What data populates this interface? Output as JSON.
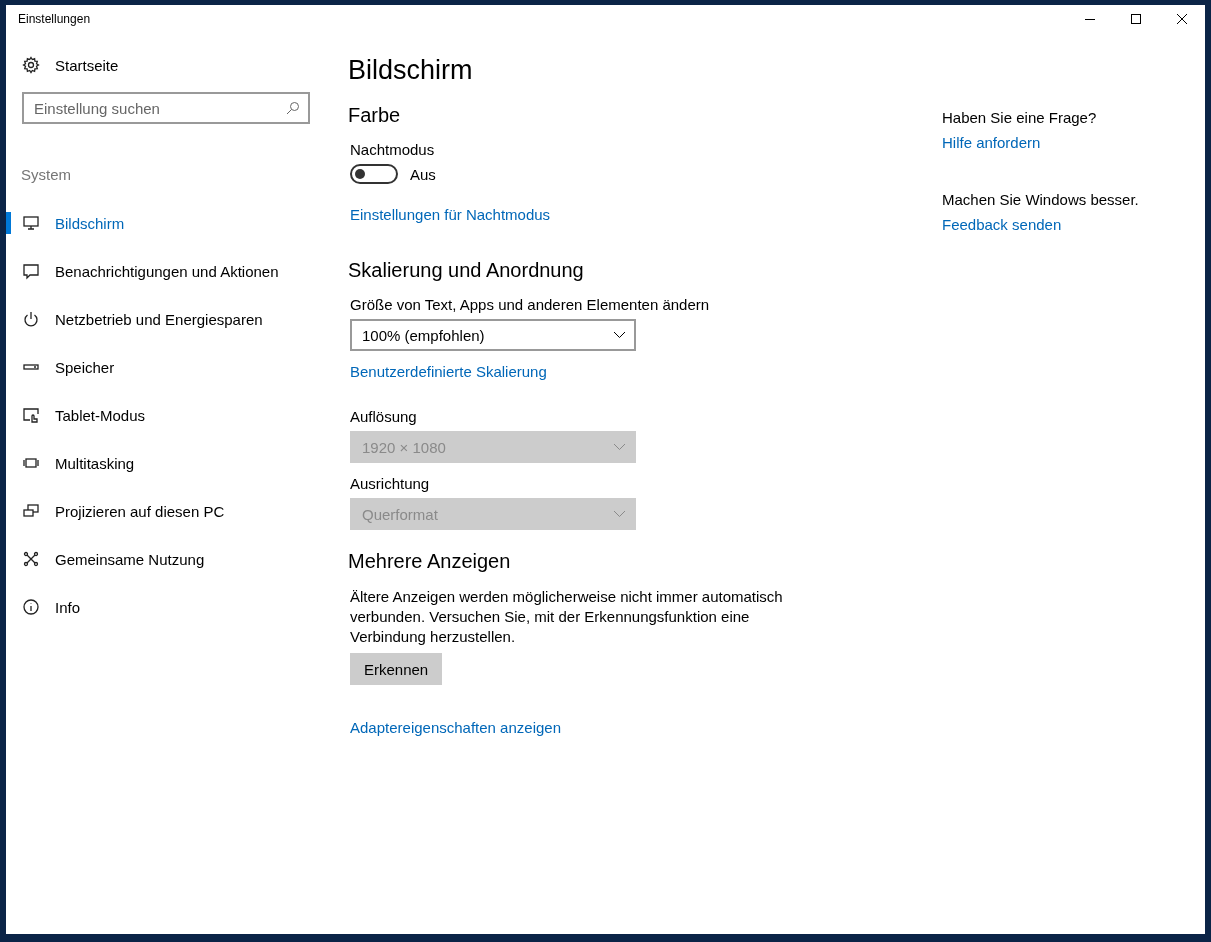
{
  "window": {
    "title": "Einstellungen"
  },
  "sidebar": {
    "home": "Startseite",
    "search": {
      "placeholder": "Einstellung suchen"
    },
    "section": "System",
    "items": [
      {
        "label": "Bildschirm",
        "selected": true
      },
      {
        "label": "Benachrichtigungen und Aktionen",
        "selected": false
      },
      {
        "label": "Netzbetrieb und Energiesparen",
        "selected": false
      },
      {
        "label": "Speicher",
        "selected": false
      },
      {
        "label": "Tablet-Modus",
        "selected": false
      },
      {
        "label": "Multitasking",
        "selected": false
      },
      {
        "label": "Projizieren auf diesen PC",
        "selected": false
      },
      {
        "label": "Gemeinsame Nutzung",
        "selected": false
      },
      {
        "label": "Info",
        "selected": false
      }
    ]
  },
  "page": {
    "title": "Bildschirm",
    "sections": [
      {
        "heading": "Farbe",
        "items": [
          {
            "kind": "toggle",
            "label": "Nachtmodus",
            "on": false,
            "state_text": "Aus"
          },
          {
            "kind": "link",
            "text": "Einstellungen für Nachtmodus"
          }
        ]
      },
      {
        "heading": "Skalierung und Anordnung",
        "items": [
          {
            "kind": "dropdown",
            "label": "Größe von Text, Apps und anderen Elementen ändern",
            "value": "100% (empfohlen)",
            "disabled": false
          },
          {
            "kind": "link",
            "text": "Benutzerdefinierte Skalierung"
          },
          {
            "kind": "dropdown",
            "label": "Auflösung",
            "value": "1920 × 1080",
            "disabled": true
          },
          {
            "kind": "dropdown",
            "label": "Ausrichtung",
            "value": "Querformat",
            "disabled": true
          }
        ]
      },
      {
        "heading": "Mehrere Anzeigen",
        "items": [
          {
            "kind": "text",
            "text": "Ältere Anzeigen werden möglicherweise nicht immer automatisch verbunden. Versuchen Sie, mit der Erkennungsfunktion eine Verbindung herzustellen."
          },
          {
            "kind": "button",
            "text": "Erkennen"
          },
          {
            "kind": "link",
            "text": "Adaptereigenschaften anzeigen"
          }
        ]
      }
    ]
  },
  "aside": [
    {
      "question": "Haben Sie eine Frage?",
      "link": "Hilfe anfordern"
    },
    {
      "question": "Machen Sie Windows besser.",
      "link": "Feedback senden"
    }
  ]
}
